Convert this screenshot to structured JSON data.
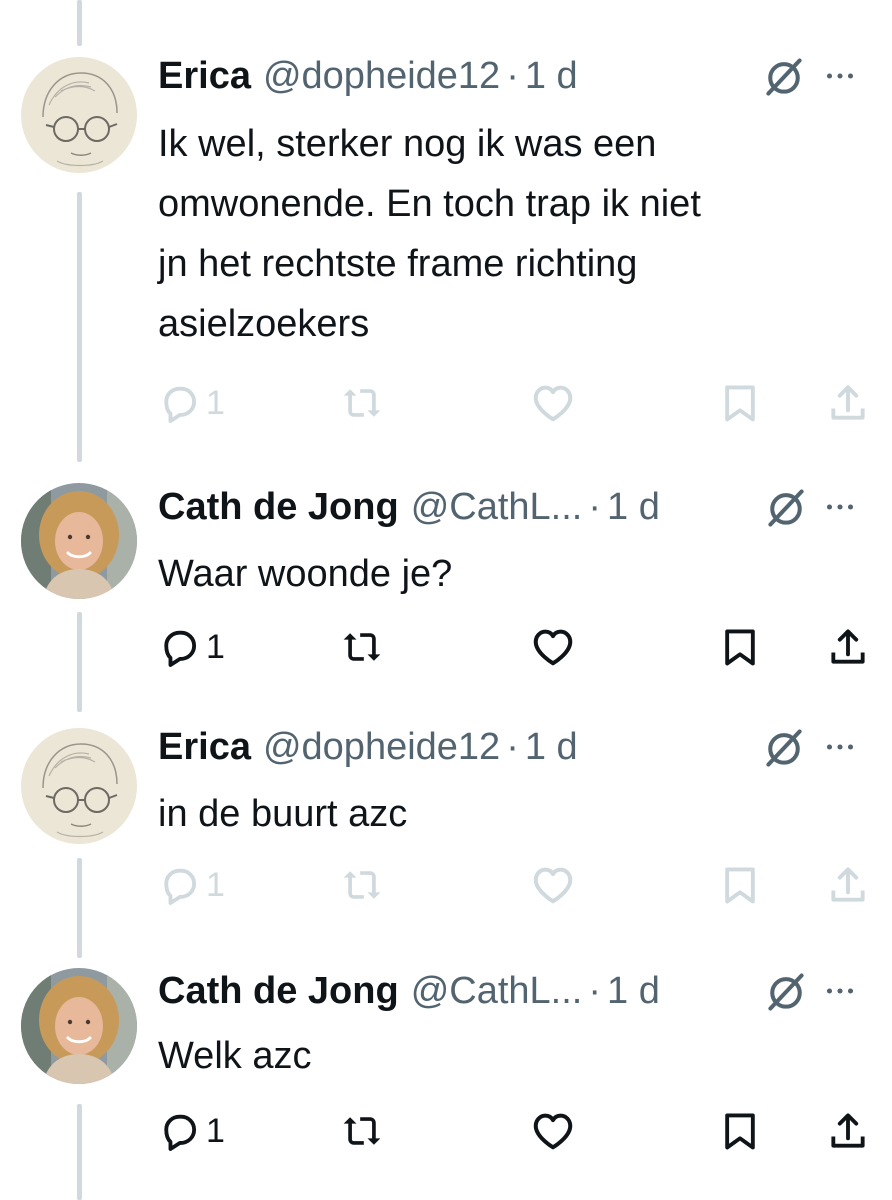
{
  "colors": {
    "text": "#0f1419",
    "secondary": "#536471",
    "faded": "#cfd9de",
    "thread_line": "#cfd9de"
  },
  "tweets": [
    {
      "name": "Erica",
      "handle": "@dopheide12",
      "separator": "·",
      "time": "1 d",
      "text_lines": [
        "Ik wel, sterker nog ik was een",
        "omwonende. En toch trap ik niet",
        "jn het rechtste frame richting",
        "asielzoekers"
      ],
      "reply_count": "1",
      "avatar": "sketch-portrait-avatar"
    },
    {
      "name": "Cath de Jong",
      "handle": "@CathL...",
      "separator": "·",
      "time": "1 d",
      "text_lines": [
        "Waar woonde je?"
      ],
      "reply_count": "1",
      "avatar": "photo-portrait-avatar"
    },
    {
      "name": "Erica",
      "handle": "@dopheide12",
      "separator": "·",
      "time": "1 d",
      "text_lines": [
        "in de buurt azc"
      ],
      "reply_count": "1",
      "avatar": "sketch-portrait-avatar"
    },
    {
      "name": "Cath de Jong",
      "handle": "@CathL...",
      "separator": "·",
      "time": "1 d",
      "text_lines": [
        "Welk azc"
      ],
      "reply_count": "1",
      "avatar": "photo-portrait-avatar"
    }
  ]
}
